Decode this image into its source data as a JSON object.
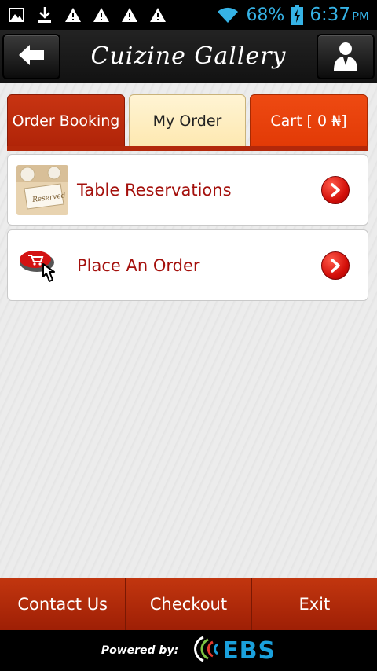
{
  "status_bar": {
    "battery_percent": "68%",
    "time": "6:37",
    "ampm": "PM",
    "icons": [
      "image-icon",
      "download-icon",
      "warning-icon",
      "warning-icon",
      "warning-icon",
      "warning-icon",
      "wifi-icon",
      "battery-icon"
    ]
  },
  "header": {
    "title": "Cuizine Gallery",
    "back_icon": "back-arrow-icon",
    "profile_icon": "user-icon"
  },
  "tabs": [
    {
      "label": "Order Booking"
    },
    {
      "label": "My Order"
    },
    {
      "label": "Cart [ 0 ₦]"
    }
  ],
  "menu": [
    {
      "label": "Table Reservations",
      "icon": "reserved-table-icon"
    },
    {
      "label": "Place An Order",
      "icon": "cart-click-icon"
    }
  ],
  "bottom_bar": {
    "contact": "Contact Us",
    "checkout": "Checkout",
    "exit": "Exit"
  },
  "footer": {
    "powered_by": "Powered by:",
    "brand": "EBS"
  },
  "colors": {
    "accent_red": "#b3280a",
    "cart_orange": "#e23a06",
    "label_red": "#a4100c",
    "status_blue": "#36b3e6",
    "ebs_blue": "#1aa0dc"
  }
}
